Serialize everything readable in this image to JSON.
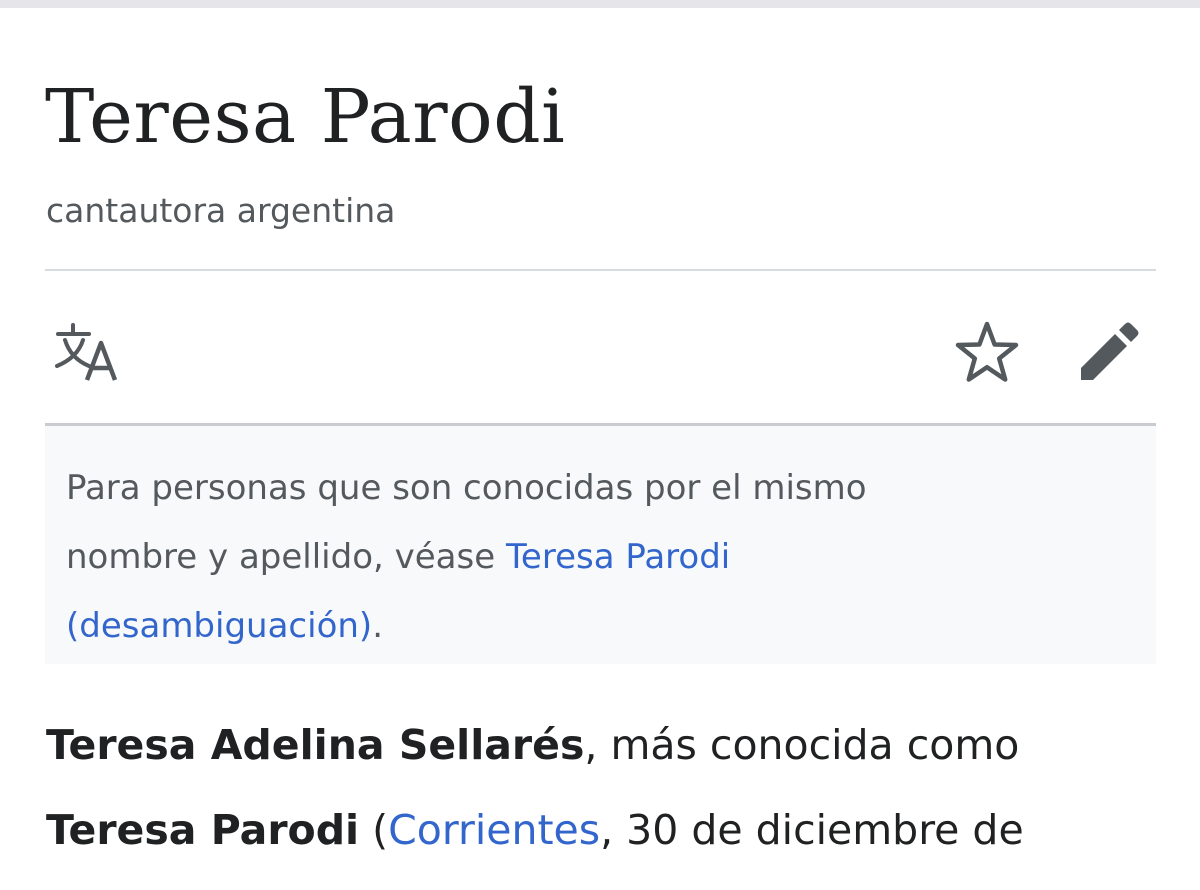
{
  "article": {
    "title": "Teresa Parodi",
    "description": "cantautora argentina"
  },
  "toolbar": {
    "language_icon": "translate-icon",
    "watch_icon": "star-outline-icon",
    "edit_icon": "pencil-icon"
  },
  "hatnote": {
    "text_line1": "Para personas que son conocidas por el mismo",
    "text_line2": "nombre y apellido, véase ",
    "link_part1": "Teresa Parodi",
    "link_part2": "(desambiguación)",
    "trailing": "."
  },
  "lead": {
    "bold_name": "Teresa Adelina Sellarés",
    "text_1": ", más conocida como",
    "bold_alias": "Teresa Parodi",
    "text_2": " (",
    "birthplace_link": "Corrientes",
    "text_3": ", 30 de diciembre de"
  },
  "colors": {
    "link": "#3366cc",
    "text": "#202122",
    "muted": "#54595d",
    "hatnote_bg": "#f8f9fa"
  }
}
